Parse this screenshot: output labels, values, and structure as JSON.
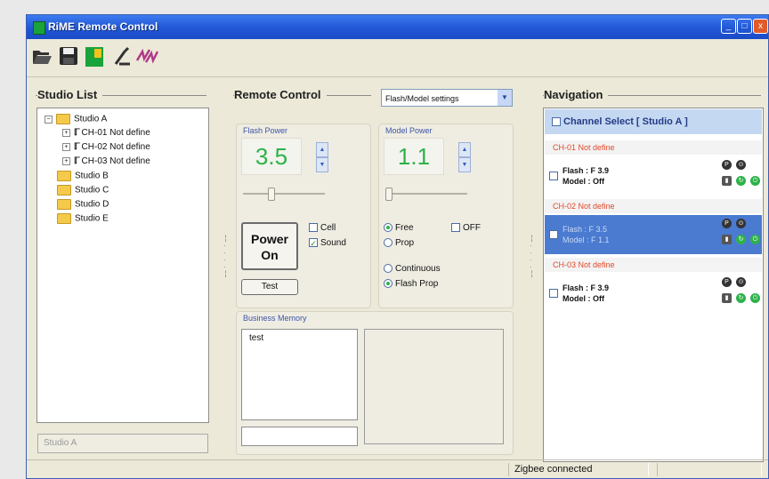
{
  "window": {
    "title": "RiME Remote Control"
  },
  "toolbar": {
    "icons": [
      "open-folder-icon",
      "save-icon",
      "rime-logo-icon",
      "tools-icon",
      "link-icon"
    ]
  },
  "studio_list": {
    "label": "Studio List",
    "studio_a": "Studio A",
    "channels": [
      "CH-01 Not define",
      "CH-02 Not define",
      "CH-03 Not define"
    ],
    "other_studios": [
      "Studio B",
      "Studio C",
      "Studio D",
      "Studio E"
    ],
    "selected_field": "Studio A"
  },
  "remote_control": {
    "label": "Remote Control",
    "mode_select": "Flash/Model settings",
    "flash_power_label": "Flash Power",
    "flash_power_value": "3.5",
    "model_power_label": "Model Power",
    "model_power_value": "1.1",
    "power_button_line1": "Power",
    "power_button_line2": "On",
    "test_button": "Test",
    "cell_label": "Cell",
    "sound_label": "Sound",
    "free_label": "Free",
    "off_label": "OFF",
    "prop_label": "Prop",
    "continuous_label": "Continuous",
    "flash_prop_label": "Flash Prop",
    "business_memory_label": "Business Memory",
    "memory_item": "test"
  },
  "navigation": {
    "label": "Navigation",
    "channel_select": "Channel Select [ Studio A ]",
    "channels": [
      {
        "header": "CH-01  Not define",
        "flash": "Flash : F 3.9",
        "model": "Model : Off"
      },
      {
        "header": "CH-02  Not define",
        "flash": "Flash : F 3.5",
        "model": "Model : F 1.1"
      },
      {
        "header": "CH-03  Not define",
        "flash": "Flash : F 3.9",
        "model": "Model : Off"
      }
    ]
  },
  "status": {
    "connection": "Zigbee connected"
  },
  "colors": {
    "accent": "#2156d5",
    "value_green": "#2db24a",
    "selection": "#4a7bd0",
    "channel_header": "#e04a2a"
  }
}
